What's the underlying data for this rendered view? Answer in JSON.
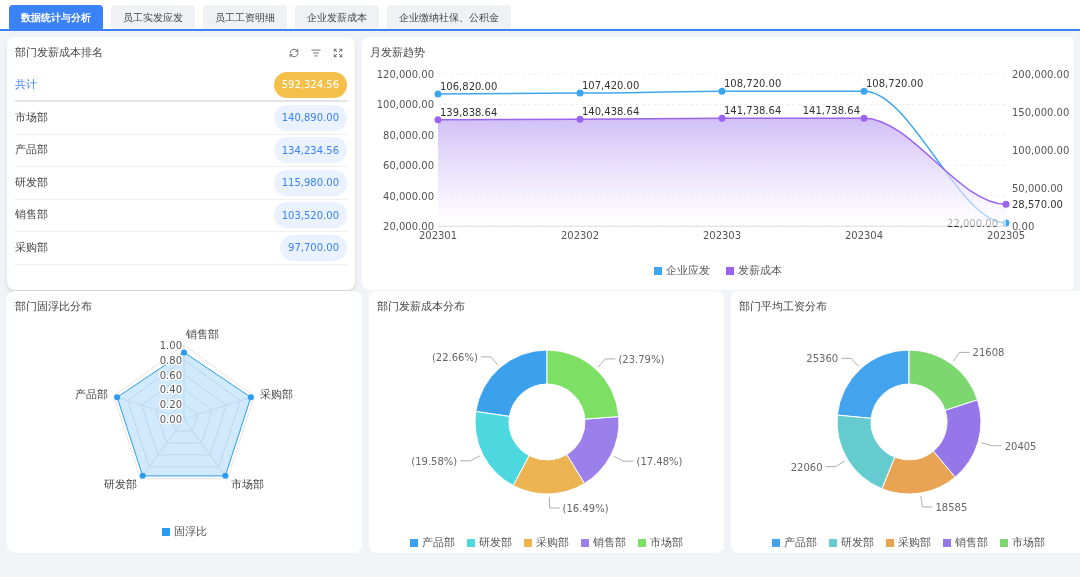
{
  "tabs": [
    {
      "label": "数据统计与分析",
      "selected": true
    },
    {
      "label": "员工实发应发",
      "selected": false
    },
    {
      "label": "员工工资明细",
      "selected": false
    },
    {
      "label": "企业发薪成本",
      "selected": false
    },
    {
      "label": "企业缴纳社保、公积金",
      "selected": false
    }
  ],
  "ranking": {
    "title": "部门发薪成本排名",
    "rows": [
      {
        "kind": "total",
        "name": "共计",
        "amount": "592,324.56"
      },
      {
        "kind": "dept",
        "name": "市场部",
        "amount": "140,890.00"
      },
      {
        "kind": "dept",
        "name": "产品部",
        "amount": "134,234.56"
      },
      {
        "kind": "dept",
        "name": "研发部",
        "amount": "115,980.00"
      },
      {
        "kind": "dept",
        "name": "销售部",
        "amount": "103,520.00"
      },
      {
        "kind": "dept",
        "name": "采购部",
        "amount": "97,700.00"
      }
    ]
  },
  "trend": {
    "title": "月发薪趋势",
    "chart_data": {
      "type": "line",
      "categories": [
        "202301",
        "202302",
        "202303",
        "202304",
        "202305"
      ],
      "grid": true,
      "series": [
        {
          "name": "企业应发",
          "color": "#3ea6f0",
          "marker": true,
          "values": [
            106820,
            107420,
            108720,
            108720,
            22000
          ],
          "value_labels": [
            "106,820.00",
            "107,420.00",
            "108,720.00",
            "108,720.00",
            "22,000.00"
          ]
        },
        {
          "name": "发薪成本",
          "color": "#9b64ee",
          "axis": "y2",
          "type": "area",
          "marker": true,
          "values": [
            139838.64,
            140438.64,
            141738.64,
            141738.64,
            28570
          ],
          "value_labels": [
            "139,838.64",
            "140,438.64",
            "141,738.64",
            "141,738.64",
            "28,570.00"
          ]
        }
      ],
      "ylim": [
        20000,
        120000
      ],
      "yticks": [
        {
          "value": 20000,
          "label": "20,000.00"
        },
        {
          "value": 40000,
          "label": "40,000.00"
        },
        {
          "value": 60000,
          "label": "60,000.00"
        },
        {
          "value": 80000,
          "label": "80,000.00"
        },
        {
          "value": 100000,
          "label": "100,000.00"
        },
        {
          "value": 120000,
          "label": "120,000.00"
        }
      ],
      "y2lim": [
        0,
        200000
      ],
      "y2ticks": [
        {
          "value": 0,
          "label": "0.00"
        },
        {
          "value": 50000,
          "label": "50,000.00"
        },
        {
          "value": 100000,
          "label": "100,000.00"
        },
        {
          "value": 150000,
          "label": "150,000.00"
        },
        {
          "value": 200000,
          "label": "200,000.00"
        }
      ]
    }
  },
  "radar": {
    "title": "部门固浮比分布",
    "legend": "固浮比",
    "color": "#2c9cf0",
    "ticks": [
      "1.00",
      "0.80",
      "0.60",
      "0.40",
      "0.20",
      "0.00"
    ],
    "axes": [
      {
        "label": "销售部",
        "level": 0.9
      },
      {
        "label": "采购部",
        "level": 0.95
      },
      {
        "label": "市场部",
        "level": 0.95
      },
      {
        "label": "研发部",
        "level": 0.95
      },
      {
        "label": "产品部",
        "level": 0.95
      }
    ]
  },
  "donuts": [
    {
      "title": "部门发薪成本分布",
      "chart_data": {
        "type": "donut",
        "categories": [
          "产品部",
          "研发部",
          "采购部",
          "销售部",
          "市场部"
        ],
        "values": [
          22.66,
          19.58,
          16.49,
          17.48,
          23.79
        ],
        "colors": [
          "#3ba1ec",
          "#4dd8e0",
          "#ecb451",
          "#9b7fea",
          "#7ddf63"
        ],
        "value_labels": [
          "(22.66%)",
          "(19.58%)",
          "(16.49%)",
          "(17.48%)",
          "(23.79%)"
        ]
      }
    },
    {
      "title": "部门平均工资分布",
      "chart_data": {
        "type": "donut",
        "categories": [
          "产品部",
          "研发部",
          "采购部",
          "销售部",
          "市场部"
        ],
        "values": [
          25360,
          22060,
          18585,
          20405,
          21608
        ],
        "colors": [
          "#43a3ec",
          "#64cbcf",
          "#e8a452",
          "#9677ea",
          "#7dd76f"
        ],
        "value_labels": [
          "25360",
          "22060",
          "18585",
          "20405",
          "21608"
        ]
      }
    }
  ]
}
